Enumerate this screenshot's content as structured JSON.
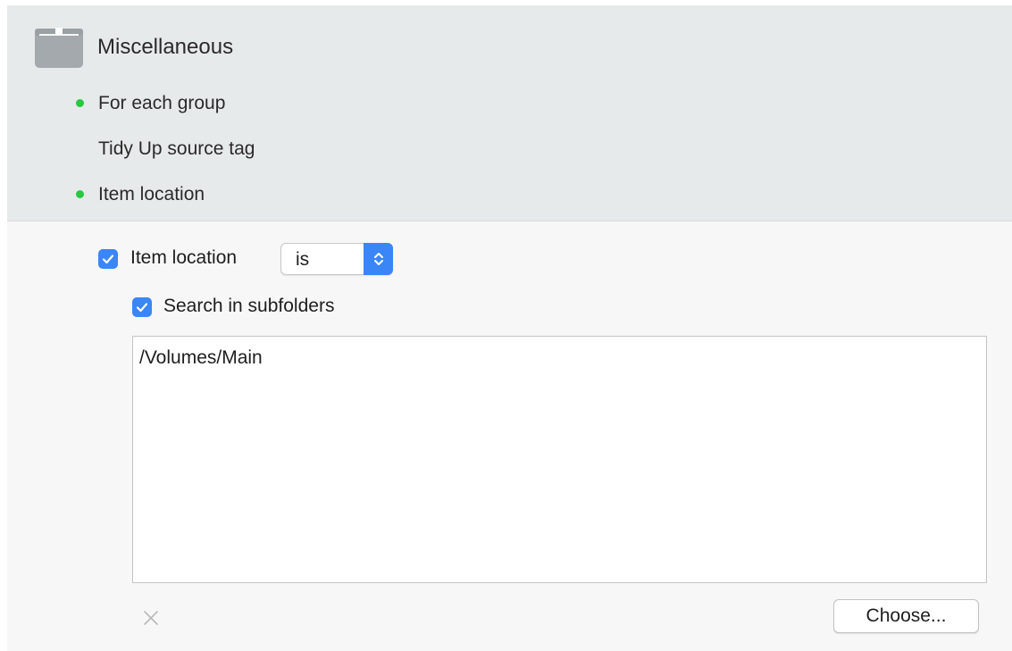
{
  "colors": {
    "header_bg": "#e7eaea",
    "panel_bg": "#f7f7f7",
    "status_green": "#28c840",
    "accent_blue": "#3b86f6",
    "icon_gray": "#a3a9ad"
  },
  "group": {
    "icon": "box-icon",
    "title": "Miscellaneous",
    "items": [
      {
        "label": "For each group",
        "active": true
      },
      {
        "label": "Tidy Up source tag",
        "active": false
      },
      {
        "label": "Item location",
        "active": true
      }
    ]
  },
  "condition": {
    "enabled_label": "Item location",
    "enabled_checked": true,
    "operator_value": "is",
    "subfolders_label": "Search in subfolders",
    "subfolders_checked": true,
    "paths": [
      "/Volumes/Main"
    ]
  },
  "footer": {
    "remove_icon": "close-icon",
    "choose_label": "Choose..."
  }
}
